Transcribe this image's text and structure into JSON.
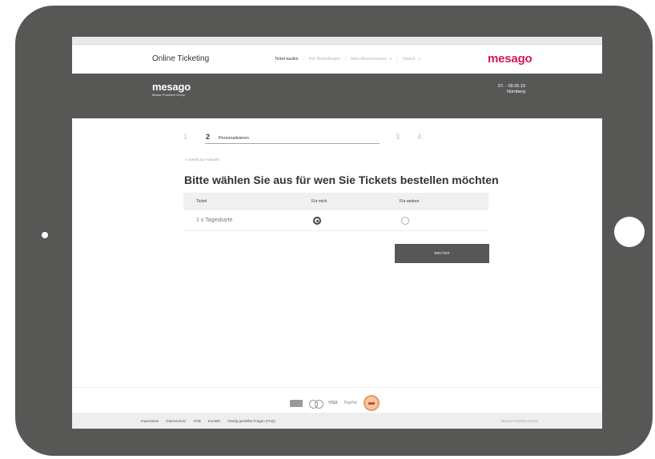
{
  "header": {
    "site_title": "Online Ticketing",
    "nav": [
      "Ticket kaufen",
      "Ihre Bestellungen",
      "Mein Museumsware",
      "Search"
    ],
    "logo": "mesago"
  },
  "band": {
    "logo": "mesago",
    "logo_sub": "Messe Frankfurt Group",
    "date": "07. - 09.05.19",
    "city": "Nürnberg"
  },
  "steps": {
    "s1": "1",
    "s2": "2",
    "s2_label": "Personalisieren",
    "s3": "3",
    "s4": "4"
  },
  "back_link": "< zurück zur Auswahl",
  "heading": "Bitte wählen Sie aus für wen Sie Tickets bestellen möchten",
  "table": {
    "headers": [
      "Ticket",
      "Für mich",
      "Für andere"
    ],
    "rows": [
      {
        "ticket": "1 x Tageskarte",
        "for_me_checked": true,
        "for_others_checked": false
      }
    ]
  },
  "button": {
    "next_label": "WEITER"
  },
  "payments": {
    "visa": "VISA",
    "paypal": "PayPal"
  },
  "footer": {
    "links": [
      "Impressum",
      "Datenschutz",
      "AGB",
      "Kontakt",
      "Häufig gestellte Fragen (FAQ)"
    ],
    "group": "Messe Frankfurt Group"
  },
  "colors": {
    "accent": "#d6175f",
    "band": "#575756",
    "frame": "#575756"
  }
}
